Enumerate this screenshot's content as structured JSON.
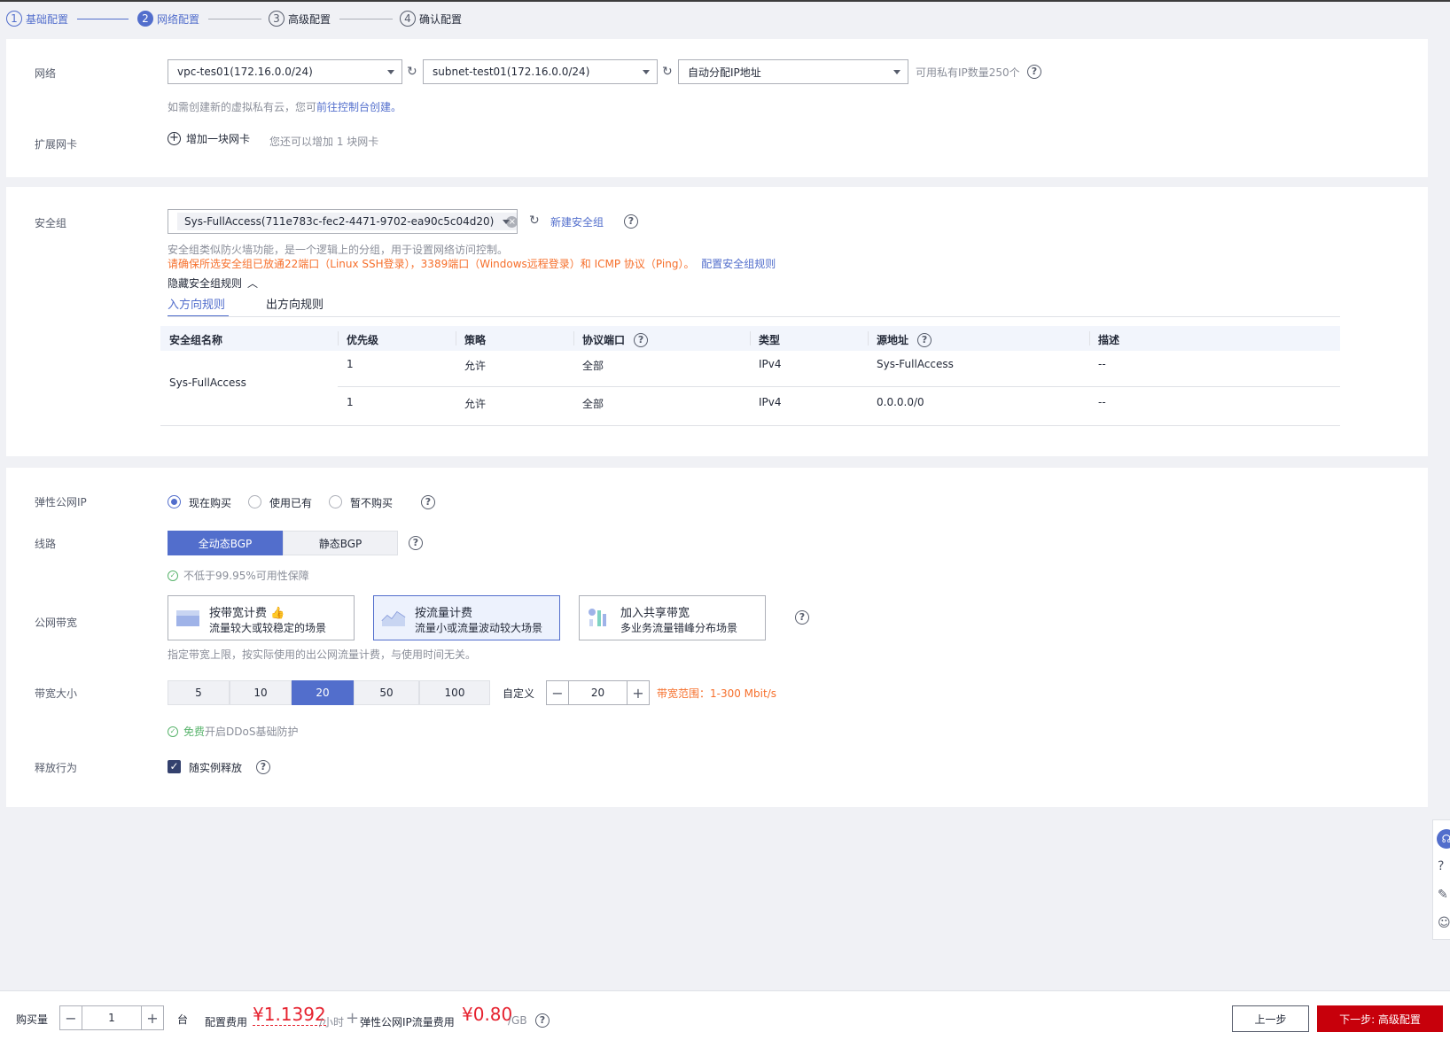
{
  "steps": [
    {
      "num": "1",
      "label": "基础配置"
    },
    {
      "num": "2",
      "label": "网络配置"
    },
    {
      "num": "3",
      "label": "高级配置"
    },
    {
      "num": "4",
      "label": "确认配置"
    }
  ],
  "network": {
    "label": "网络",
    "vpc": "vpc-tes01(172.16.0.0/24)",
    "subnet": "subnet-test01(172.16.0.0/24)",
    "ip_mode": "自动分配IP地址",
    "available_ips": "可用私有IP数量250个",
    "hint_prefix": "如需创建新的虚拟私有云，您可",
    "hint_link": "前往控制台创建。"
  },
  "ext_nic": {
    "label": "扩展网卡",
    "add_label": "增加一块网卡",
    "hint": "您还可以增加 1 块网卡"
  },
  "security_group": {
    "label": "安全组",
    "selected": "Sys-FullAccess(711e783c-fec2-4471-9702-ea90c5c04d20)",
    "create_link": "新建安全组",
    "desc": "安全组类似防火墙功能，是一个逻辑上的分组，用于设置网络访问控制。",
    "warning": "请确保所选安全组已放通22端口（Linux SSH登录），3389端口（Windows远程登录）和 ICMP 协议（Ping）。",
    "config_link": "配置安全组规则",
    "toggle": "隐藏安全组规则",
    "tabs": [
      "入方向规则",
      "出方向规则"
    ],
    "columns": [
      "安全组名称",
      "优先级",
      "策略",
      "协议端口",
      "类型",
      "源地址",
      "描述"
    ],
    "group_name": "Sys-FullAccess",
    "rows": [
      {
        "priority": "1",
        "policy": "允许",
        "protocol": "全部",
        "type": "IPv4",
        "source": "Sys-FullAccess",
        "desc": "--"
      },
      {
        "priority": "1",
        "policy": "允许",
        "protocol": "全部",
        "type": "IPv4",
        "source": "0.0.0.0/0",
        "desc": "--"
      }
    ]
  },
  "eip": {
    "label": "弹性公网IP",
    "options": [
      "现在购买",
      "使用已有",
      "暂不购买"
    ],
    "selected_index": 0
  },
  "line": {
    "label": "线路",
    "options": [
      "全动态BGP",
      "静态BGP"
    ],
    "selected_index": 0,
    "guarantee": "不低于99.95%可用性保障"
  },
  "bandwidth": {
    "label": "公网带宽",
    "cards": [
      {
        "title": "按带宽计费",
        "desc": "流量较大或较稳定的场景"
      },
      {
        "title": "按流量计费",
        "desc": "流量小或流量波动较大场景"
      },
      {
        "title": "加入共享带宽",
        "desc": "多业务流量错峰分布场景"
      }
    ],
    "selected_index": 1,
    "note": "指定带宽上限，按实际使用的出公网流量计费，与使用时间无关。"
  },
  "bw_size": {
    "label": "带宽大小",
    "options": [
      "5",
      "10",
      "20",
      "50",
      "100"
    ],
    "selected_index": 2,
    "custom_label": "自定义",
    "custom_value": "20",
    "range": "带宽范围：1-300 Mbit/s",
    "ddos_free": "免费",
    "ddos_text": "开启DDoS基础防护"
  },
  "release": {
    "label": "释放行为",
    "checkbox_label": "随实例释放"
  },
  "bottom": {
    "qty_label": "购买量",
    "qty_value": "1",
    "qty_unit": "台",
    "config_fee_label": "配置费用",
    "config_fee": "¥1.1392",
    "config_fee_unit": "/小时",
    "plus": "+",
    "eip_fee_label": "弹性公网IP流量费用",
    "eip_fee": "¥0.80",
    "eip_fee_unit": "/GB",
    "prev": "上一步",
    "next": "下一步: 高级配置"
  },
  "colors": {
    "accent": "#526ecc",
    "primary_btn": "#c7000b",
    "price": "#e6222f",
    "warning": "#f66f2b"
  }
}
